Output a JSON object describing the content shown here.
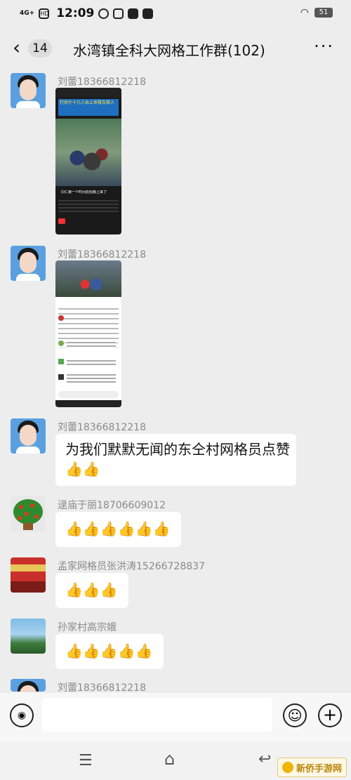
{
  "status_bar": {
    "network": "4G+",
    "hd_label": "HD",
    "time": "12:09",
    "battery": "51"
  },
  "header": {
    "back_badge": "14",
    "title": "水湾镇全科大网格工作群(102)",
    "more_label": "···"
  },
  "messages": [
    {
      "sender": "刘蕾18366812218",
      "type": "image",
      "avatar_icon": "girl-portrait-avatar"
    },
    {
      "sender": "刘蕾18366812218",
      "type": "image",
      "avatar_icon": "girl-portrait-avatar"
    },
    {
      "sender": "刘蕾18366812218",
      "type": "text",
      "text": "为我们默默无闻的东仝村网格员点赞",
      "emoji": "👍👍"
    },
    {
      "sender": "逯庙于丽18706609012",
      "type": "emoji",
      "emoji": "👍👍👍👍👍👍"
    },
    {
      "sender": "孟家网格员张洪涛15266728837",
      "type": "emoji",
      "emoji": "👍👍👍"
    },
    {
      "sender": "孙家村高宗娥",
      "type": "emoji",
      "emoji": "👍👍👍👍👍"
    },
    {
      "sender": "刘蕾18366812218",
      "type": "partial"
    }
  ],
  "screenshot1": {
    "banner": "打扮什十几人抬上来救车救人",
    "caption": "同仁第一个时间抬抬都上来了"
  },
  "input_bar": {
    "voice_icon": "voice-icon",
    "emoji_icon": "smiley-icon",
    "plus_icon": "plus-icon"
  },
  "nav_bar": {
    "menu_icon": "menu-icon",
    "home_icon": "home-icon",
    "back_icon": "back-icon"
  },
  "watermark": "新侨手游网"
}
